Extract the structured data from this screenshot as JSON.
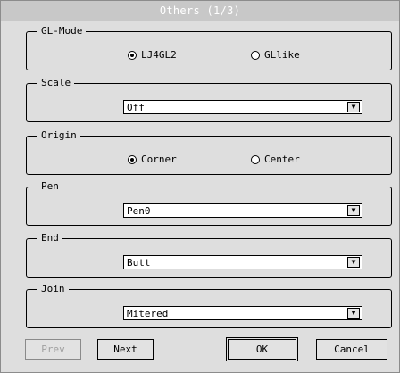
{
  "window": {
    "title": "Others (1/3)"
  },
  "groups": {
    "gl_mode": {
      "label": "GL-Mode",
      "options": [
        "LJ4GL2",
        "GLlike"
      ],
      "selected": "LJ4GL2"
    },
    "scale": {
      "label": "Scale",
      "value": "Off"
    },
    "origin": {
      "label": "Origin",
      "options": [
        "Corner",
        "Center"
      ],
      "selected": "Corner"
    },
    "pen": {
      "label": "Pen",
      "value": "Pen0"
    },
    "end": {
      "label": "End",
      "value": "Butt"
    },
    "join": {
      "label": "Join",
      "value": "Mitered"
    }
  },
  "buttons": {
    "prev": "Prev",
    "next": "Next",
    "ok": "OK",
    "cancel": "Cancel"
  },
  "icons": {
    "dropdown_arrow": "chevron-down-icon",
    "radio": "radio-icon"
  },
  "colors": {
    "background": "#dedede",
    "title_bar": "#c8c8c8",
    "title_text": "#ffffff",
    "disabled_text": "#a0a0a0"
  }
}
